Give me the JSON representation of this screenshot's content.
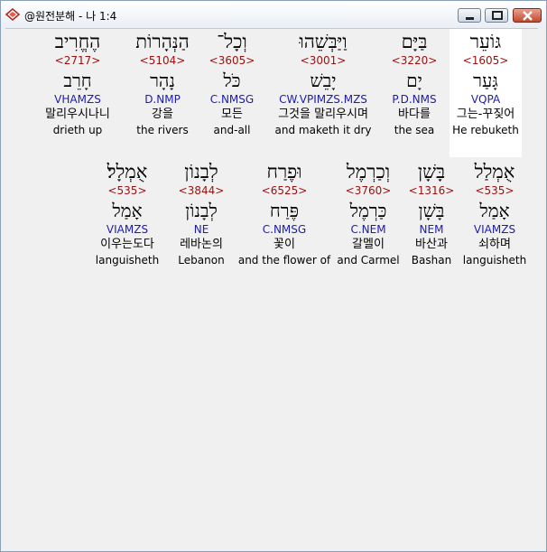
{
  "window": {
    "title": "@원전분해 - 나 1:4",
    "icons": {
      "app": "bible-app-icon",
      "minimize": "minimize-icon",
      "maximize": "maximize-icon",
      "close": "close-icon"
    },
    "colors": {
      "strong": "#9b0f0f",
      "morph": "#1b1bb3",
      "highlight": "#ffffff"
    }
  },
  "verse": {
    "rows": [
      {
        "words": [
          {
            "hebrew": "גּוֹעֵר",
            "strong": "<1605>",
            "lemma": "גָּעַר",
            "morph": "VQPA",
            "korean": "그는-꾸짖어",
            "english": "He rebuketh",
            "highlighted": true
          },
          {
            "hebrew": "בַּיָּם",
            "strong": "<3220>",
            "lemma": "יָם",
            "morph": "P.D.NMS",
            "korean": "바다를",
            "english": "the sea",
            "highlighted": false
          },
          {
            "hebrew": "וַיַּבְּשֵׁהוּ",
            "strong": "<3001>",
            "lemma": "יָבֵשׁ",
            "morph": "CW.VPIMZS.MZS",
            "korean": "그것을 말리우시며",
            "english": "and maketh it dry",
            "highlighted": false
          },
          {
            "hebrew": "וְכָל־",
            "strong": "<3605>",
            "lemma": "כֹּל",
            "morph": "C.NMSG",
            "korean": "모든",
            "english": "and-all",
            "highlighted": false
          },
          {
            "hebrew": "הַנְּהָרוֹת",
            "strong": "<5104>",
            "lemma": "נָהָר",
            "morph": "D.NMP",
            "korean": "강을",
            "english": "the rivers",
            "highlighted": false
          },
          {
            "hebrew": "הֶחֱרִיב",
            "strong": "<2717>",
            "lemma": "חָרֵב",
            "morph": "VHAMZS",
            "korean": "말리우시나니",
            "english": "drieth up",
            "highlighted": false
          }
        ]
      },
      {
        "words": [
          {
            "hebrew": "אֻמְלַל",
            "strong": "<535>",
            "lemma": "אָמַל",
            "morph": "VIAMZS",
            "korean": "쇠하며",
            "english": "languisheth",
            "highlighted": false
          },
          {
            "hebrew": "בָּשָׁן",
            "strong": "<1316>",
            "lemma": "בָּשָׁן",
            "morph": "NEM",
            "korean": "바산과",
            "english": "Bashan",
            "highlighted": false
          },
          {
            "hebrew": "וְכַרְמֶל",
            "strong": "<3760>",
            "lemma": "כַּרְמֶל",
            "morph": "C.NEM",
            "korean": "갈멜이",
            "english": "and Carmel",
            "highlighted": false
          },
          {
            "hebrew": "וּפֶרַח",
            "strong": "<6525>",
            "lemma": "פֶּרַח",
            "morph": "C.NMSG",
            "korean": "꽃이",
            "english": "and the flower of",
            "highlighted": false
          },
          {
            "hebrew": "לְבָנוֹן",
            "strong": "<3844>",
            "lemma": "לְבָנוֹן",
            "morph": "NE",
            "korean": "레바논의",
            "english": "Lebanon",
            "highlighted": false
          },
          {
            "hebrew": "אֻמְלָל׃",
            "strong": "<535>",
            "lemma": "אָמַל",
            "morph": "VIAMZS",
            "korean": "이우는도다",
            "english": "languisheth",
            "highlighted": false
          }
        ]
      }
    ]
  }
}
